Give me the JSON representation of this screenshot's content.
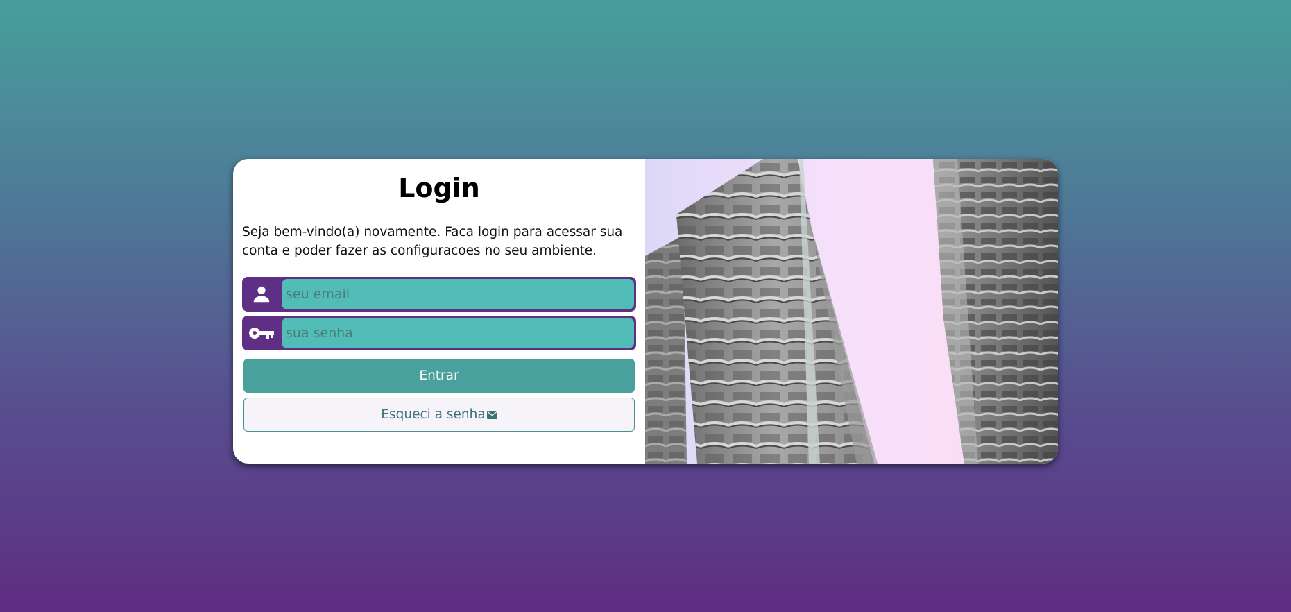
{
  "login": {
    "title": "Login",
    "description": "Seja bem-vindo(a) novamente. Faca login para acessar sua conta e poder fazer as configuracoes no seu ambiente.",
    "email_placeholder": "seu email",
    "password_placeholder": "sua senha",
    "submit_label": "Entrar",
    "forgot_label": "Esqueci a senha"
  },
  "icons": {
    "email_field": "person-icon",
    "password_field": "key-icon",
    "forgot_button": "envelope-icon",
    "side_image": "building-photo"
  },
  "colors": {
    "field_frame": "#5f2e85",
    "field_fill": "#52bdb7",
    "primary_button": "#48a19d",
    "forgot_text": "#3b7178"
  }
}
